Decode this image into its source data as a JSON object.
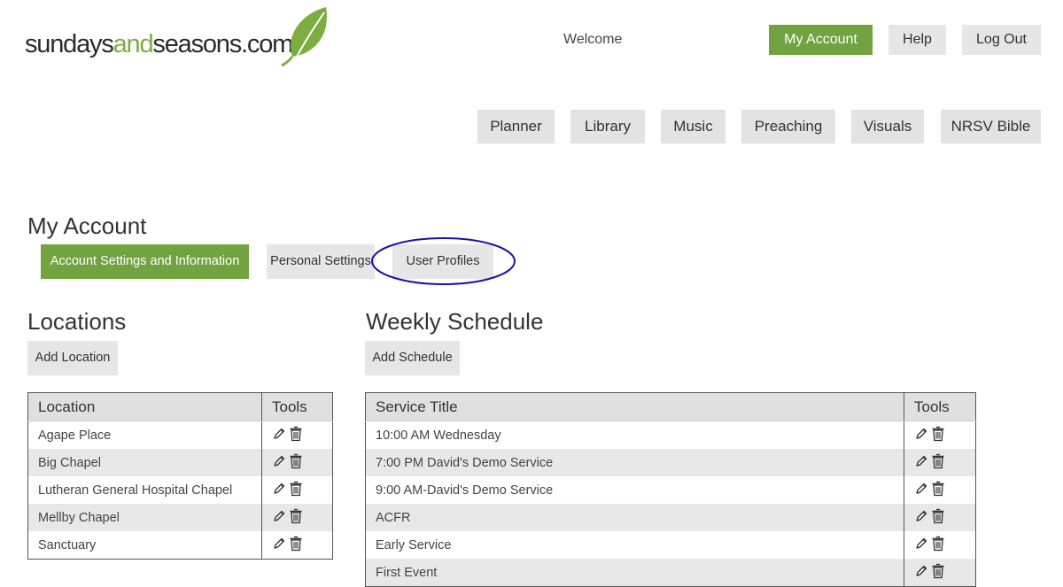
{
  "logo": {
    "part1": "sundays",
    "part2": "and",
    "part3": "seasons",
    "part4": ".com"
  },
  "header": {
    "welcome": "Welcome",
    "my_account": "My Account",
    "help": "Help",
    "logout": "Log Out"
  },
  "nav": [
    "Planner",
    "Library",
    "Music",
    "Preaching",
    "Visuals",
    "NRSV Bible"
  ],
  "page_title": "My Account",
  "subtabs": [
    "Account Settings and Information",
    "Personal Settings",
    "User Profiles"
  ],
  "locations": {
    "title": "Locations",
    "add_label": "Add Location",
    "headers": [
      "Location",
      "Tools"
    ],
    "rows": [
      "Agape Place",
      "Big Chapel",
      "Lutheran General Hospital Chapel",
      "Mellby Chapel",
      "Sanctuary"
    ]
  },
  "schedule": {
    "title": "Weekly Schedule",
    "add_label": "Add Schedule",
    "headers": [
      "Service Title",
      "Tools"
    ],
    "rows": [
      "10:00 AM Wednesday",
      "7:00 PM David's Demo Service",
      "9:00 AM-David's Demo Service",
      "ACFR",
      "Early Service",
      "First Event"
    ]
  },
  "colors": {
    "brand_green": "#71a340",
    "logo_green": "#7cae3f",
    "highlight_ring": "#1a12a8",
    "button_gray": "#e6e6e6"
  },
  "icons": {
    "edit": "pencil-icon",
    "delete": "trash-icon",
    "logo": "leaf-icon"
  }
}
